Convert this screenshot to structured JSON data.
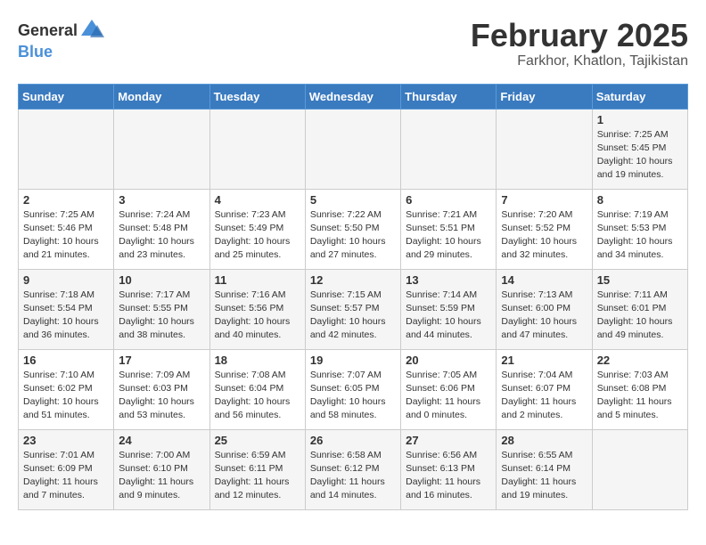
{
  "header": {
    "logo_general": "General",
    "logo_blue": "Blue",
    "title": "February 2025",
    "subtitle": "Farkhor, Khatlon, Tajikistan"
  },
  "days_of_week": [
    "Sunday",
    "Monday",
    "Tuesday",
    "Wednesday",
    "Thursday",
    "Friday",
    "Saturday"
  ],
  "weeks": [
    [
      {
        "day": "",
        "info": ""
      },
      {
        "day": "",
        "info": ""
      },
      {
        "day": "",
        "info": ""
      },
      {
        "day": "",
        "info": ""
      },
      {
        "day": "",
        "info": ""
      },
      {
        "day": "",
        "info": ""
      },
      {
        "day": "1",
        "info": "Sunrise: 7:25 AM\nSunset: 5:45 PM\nDaylight: 10 hours\nand 19 minutes."
      }
    ],
    [
      {
        "day": "2",
        "info": "Sunrise: 7:25 AM\nSunset: 5:46 PM\nDaylight: 10 hours\nand 21 minutes."
      },
      {
        "day": "3",
        "info": "Sunrise: 7:24 AM\nSunset: 5:48 PM\nDaylight: 10 hours\nand 23 minutes."
      },
      {
        "day": "4",
        "info": "Sunrise: 7:23 AM\nSunset: 5:49 PM\nDaylight: 10 hours\nand 25 minutes."
      },
      {
        "day": "5",
        "info": "Sunrise: 7:22 AM\nSunset: 5:50 PM\nDaylight: 10 hours\nand 27 minutes."
      },
      {
        "day": "6",
        "info": "Sunrise: 7:21 AM\nSunset: 5:51 PM\nDaylight: 10 hours\nand 29 minutes."
      },
      {
        "day": "7",
        "info": "Sunrise: 7:20 AM\nSunset: 5:52 PM\nDaylight: 10 hours\nand 32 minutes."
      },
      {
        "day": "8",
        "info": "Sunrise: 7:19 AM\nSunset: 5:53 PM\nDaylight: 10 hours\nand 34 minutes."
      }
    ],
    [
      {
        "day": "9",
        "info": "Sunrise: 7:18 AM\nSunset: 5:54 PM\nDaylight: 10 hours\nand 36 minutes."
      },
      {
        "day": "10",
        "info": "Sunrise: 7:17 AM\nSunset: 5:55 PM\nDaylight: 10 hours\nand 38 minutes."
      },
      {
        "day": "11",
        "info": "Sunrise: 7:16 AM\nSunset: 5:56 PM\nDaylight: 10 hours\nand 40 minutes."
      },
      {
        "day": "12",
        "info": "Sunrise: 7:15 AM\nSunset: 5:57 PM\nDaylight: 10 hours\nand 42 minutes."
      },
      {
        "day": "13",
        "info": "Sunrise: 7:14 AM\nSunset: 5:59 PM\nDaylight: 10 hours\nand 44 minutes."
      },
      {
        "day": "14",
        "info": "Sunrise: 7:13 AM\nSunset: 6:00 PM\nDaylight: 10 hours\nand 47 minutes."
      },
      {
        "day": "15",
        "info": "Sunrise: 7:11 AM\nSunset: 6:01 PM\nDaylight: 10 hours\nand 49 minutes."
      }
    ],
    [
      {
        "day": "16",
        "info": "Sunrise: 7:10 AM\nSunset: 6:02 PM\nDaylight: 10 hours\nand 51 minutes."
      },
      {
        "day": "17",
        "info": "Sunrise: 7:09 AM\nSunset: 6:03 PM\nDaylight: 10 hours\nand 53 minutes."
      },
      {
        "day": "18",
        "info": "Sunrise: 7:08 AM\nSunset: 6:04 PM\nDaylight: 10 hours\nand 56 minutes."
      },
      {
        "day": "19",
        "info": "Sunrise: 7:07 AM\nSunset: 6:05 PM\nDaylight: 10 hours\nand 58 minutes."
      },
      {
        "day": "20",
        "info": "Sunrise: 7:05 AM\nSunset: 6:06 PM\nDaylight: 11 hours\nand 0 minutes."
      },
      {
        "day": "21",
        "info": "Sunrise: 7:04 AM\nSunset: 6:07 PM\nDaylight: 11 hours\nand 2 minutes."
      },
      {
        "day": "22",
        "info": "Sunrise: 7:03 AM\nSunset: 6:08 PM\nDaylight: 11 hours\nand 5 minutes."
      }
    ],
    [
      {
        "day": "23",
        "info": "Sunrise: 7:01 AM\nSunset: 6:09 PM\nDaylight: 11 hours\nand 7 minutes."
      },
      {
        "day": "24",
        "info": "Sunrise: 7:00 AM\nSunset: 6:10 PM\nDaylight: 11 hours\nand 9 minutes."
      },
      {
        "day": "25",
        "info": "Sunrise: 6:59 AM\nSunset: 6:11 PM\nDaylight: 11 hours\nand 12 minutes."
      },
      {
        "day": "26",
        "info": "Sunrise: 6:58 AM\nSunset: 6:12 PM\nDaylight: 11 hours\nand 14 minutes."
      },
      {
        "day": "27",
        "info": "Sunrise: 6:56 AM\nSunset: 6:13 PM\nDaylight: 11 hours\nand 16 minutes."
      },
      {
        "day": "28",
        "info": "Sunrise: 6:55 AM\nSunset: 6:14 PM\nDaylight: 11 hours\nand 19 minutes."
      },
      {
        "day": "",
        "info": ""
      }
    ]
  ]
}
